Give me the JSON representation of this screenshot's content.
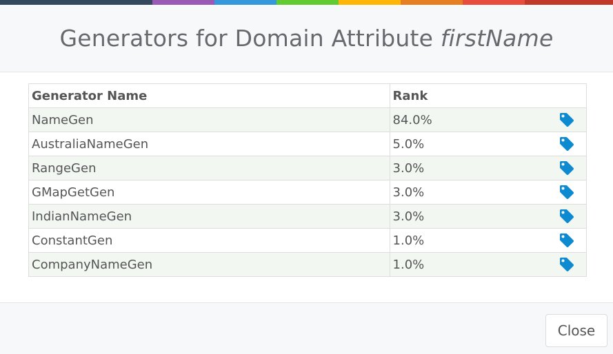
{
  "color_strip": [
    "#34495e",
    "#9b59b6",
    "#3498db",
    "#62cb31",
    "#ffb606",
    "#e67e22",
    "#e74c3c",
    "#c0392b"
  ],
  "header": {
    "title_prefix": "Generators for Domain Attribute",
    "title_attribute": "firstName"
  },
  "table": {
    "columns": [
      "Generator Name",
      "Rank"
    ],
    "rows": [
      {
        "name": "NameGen",
        "rank": "84.0%"
      },
      {
        "name": "AustraliaNameGen",
        "rank": "5.0%"
      },
      {
        "name": "RangeGen",
        "rank": "3.0%"
      },
      {
        "name": "GMapGetGen",
        "rank": "3.0%"
      },
      {
        "name": "IndianNameGen",
        "rank": "3.0%"
      },
      {
        "name": "ConstantGen",
        "rank": "1.0%"
      },
      {
        "name": "CompanyNameGen",
        "rank": "1.0%"
      }
    ],
    "row_icon": "tag-icon",
    "icon_color": "#0e8ad0"
  },
  "footer": {
    "close_label": "Close"
  }
}
